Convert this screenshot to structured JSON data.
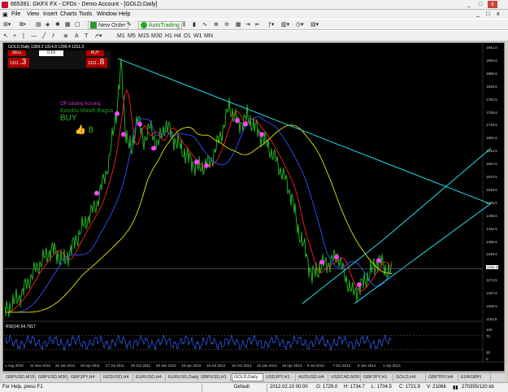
{
  "window": {
    "title": "665391: GKFX FX - CFDs - Demo Account - [GOLD,Daily]",
    "minimize": "_",
    "maximize": "□",
    "close": "x",
    "inner_minimize": "_",
    "inner_restore": "□",
    "inner_close": "x"
  },
  "menu": [
    "File",
    "View",
    "Insert",
    "Charts",
    "Tools",
    "Window",
    "Help"
  ],
  "toolbar": {
    "new_order": "New Order",
    "autotrading": "AutoTrading",
    "timeframes": [
      "M1",
      "M5",
      "M15",
      "M30",
      "H1",
      "H4",
      "D1",
      "W1",
      "MN"
    ]
  },
  "chart": {
    "ohlc": "GOLD,Daily  1309.2 1314.8 1299.4 1311.3",
    "trade_panel": {
      "sell": "SELL",
      "buy": "BUY",
      "lot": "0.10",
      "sell_price_small": "1311",
      "sell_price_big": ".3",
      "buy_price_small": "1311",
      "buy_price_big": ".8"
    },
    "indicator_text": {
      "line1": "OP tubang kosong",
      "line2": "Kondisi Masih Bagus",
      "line3": "BUY",
      "line4": "👍 8"
    },
    "rsi_label": "RSI(14) 54.7917",
    "price_scale": [
      "1941.0",
      "1904.6",
      "1866.5",
      "1829.6",
      "1792.5",
      "1755.6",
      "1718.5",
      "1681.6",
      "1644.5",
      "1607.6",
      "1570.5",
      "1533.6",
      "1496.5",
      "1459.6",
      "1422.5",
      "1385.6",
      "1348.5",
      "1311.3",
      "1274.5",
      "1237.6",
      "1200.5",
      "1163.6"
    ],
    "current_price": "1311.3",
    "rsi_scale": [
      "100",
      "70",
      "30",
      "0"
    ],
    "date_scale": [
      "1 Aug 2010",
      "11 Nov 2010",
      "26 Jan 2011",
      "20 Apr 2011",
      "27 Jul 2011",
      "25 Oct 2011",
      "20 Jan 2012",
      "19 Apr 2012",
      "18 Jul 2012",
      "16 Oct 2012",
      "15 Jan 2013",
      "15 Apr 2013",
      "9 Jul 2013",
      "7 Oct 2013",
      "6 Jan 2014",
      "1 Apr 2014"
    ],
    "colors": {
      "background": "#000000",
      "price_line": "#21c021",
      "ma_fast": "#ff2020",
      "ma_mid": "#3050ff",
      "ma_slow": "#e6e600",
      "trendline": "#20e0e8",
      "markers": "#ff44ff",
      "rsi": "#3060ff"
    }
  },
  "tabs": [
    "GBPUSD,M15",
    "GBPUSD,M30",
    "GBPJPY,H4",
    "NZDUSD,H4",
    "EURUSD,H4",
    "EURUSD,Daily",
    "GBPUSD,H1",
    "GOLD,Daily",
    "USDJPY,H1",
    "AUDUSD,H4",
    "USDCAD,M30",
    "GBPJPY,H1",
    "GOLD,H4",
    "GBPTRY,H4",
    "EURGBP,I"
  ],
  "active_tab": "GOLD,Daily",
  "status": {
    "help": "For Help, press F1",
    "profile": "Default",
    "datetime": "2012.02.10 00:00",
    "open": "O: 1729.0",
    "high": "H: 1734.7",
    "low": "L: 1704.5",
    "close": "C: 1721.9",
    "volume": "V: 21066",
    "traffic": "270355/120 kb"
  }
}
